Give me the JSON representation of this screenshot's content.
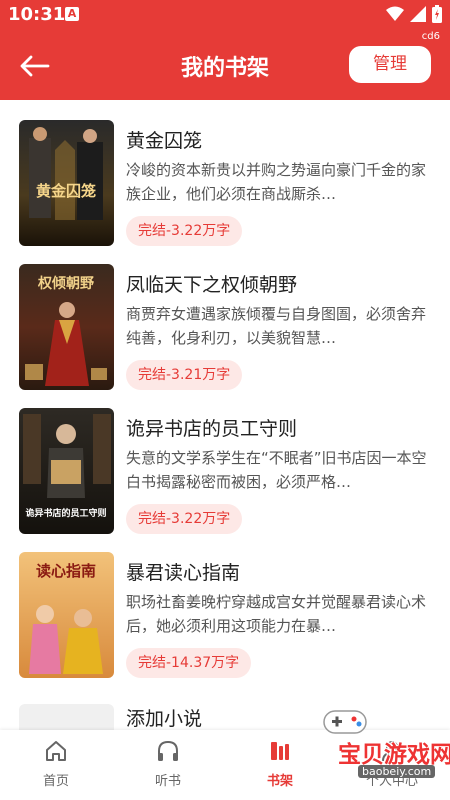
{
  "status_bar": {
    "time": "10:31",
    "notif_glyph": "A",
    "icons": [
      "wifi-icon",
      "signal-icon",
      "battery-icon"
    ]
  },
  "header": {
    "title": "我的书架",
    "manage_label": "管理",
    "corner_tag": "cd6",
    "back_icon": "arrow-left-icon"
  },
  "books": [
    {
      "title": "黄金囚笼",
      "desc": "冷峻的资本新贵以并购之势逼向豪门千金的家族企业，他们必须在商战厮杀…",
      "badge": "完结-3.22万字",
      "cover_text": "黄金囚笼"
    },
    {
      "title": "凤临天下之权倾朝野",
      "desc": "商贾弃女遭遇家族倾覆与自身图圄，必须舍弃纯善，化身利刃，以美貌智慧…",
      "badge": "完结-3.21万字",
      "cover_text": "权倾朝野"
    },
    {
      "title": "诡异书店的员工守则",
      "desc": "失意的文学系学生在“不眠者”旧书店因一本空白书揭露秘密而被困，必须严格…",
      "badge": "完结-3.22万字",
      "cover_text": "诡异书店的员工守则"
    },
    {
      "title": "暴君读心指南",
      "desc": "职场社畜姜晚柠穿越成宫女并觉醒暴君读心术后，她必须利用这项能力在暴…",
      "badge": "完结-14.37万字",
      "cover_text": "读心指南"
    }
  ],
  "add_novel": {
    "label": "添加小说"
  },
  "tabs": [
    {
      "label": "首页",
      "icon": "home-icon"
    },
    {
      "label": "听书",
      "icon": "headphones-icon"
    },
    {
      "label": "书架",
      "icon": "bookshelf-icon"
    },
    {
      "label": "个人中心",
      "icon": "user-icon"
    }
  ],
  "watermark": {
    "text": "宝贝游戏网",
    "url": "baobeiy.com"
  },
  "colors": {
    "accent": "#e63b37",
    "badge_bg": "#fde8e6"
  }
}
